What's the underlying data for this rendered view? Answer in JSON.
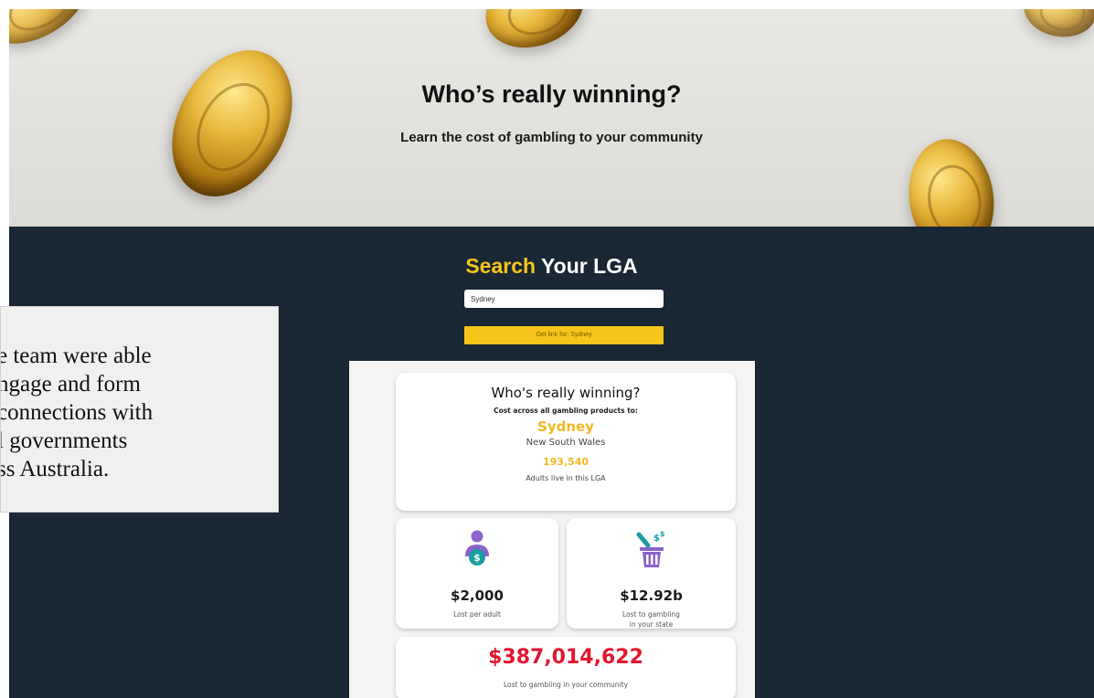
{
  "hero": {
    "title": "Who’s really winning?",
    "subtitle": "Learn the cost of gambling to your community"
  },
  "search": {
    "title_highlight": "Search",
    "title_rest": " Your LGA",
    "input_value": "Sydney",
    "button_label": "Get link for: Sydney"
  },
  "result": {
    "title": "Who's really winning?",
    "subtitle": "Cost across all gambling products to:",
    "city": "Sydney",
    "state": "New South Wales",
    "adults_count": "193,540",
    "adults_label": "Adults live in this LGA"
  },
  "stats": {
    "per_adult_value": "$2,000",
    "per_adult_label": "Lost per adult",
    "per_adult_icon": "person-money-icon",
    "state_value": "$12.92b",
    "state_label_line1": "Lost to gambling",
    "state_label_line2": "in your state",
    "state_icon": "money-bin-icon",
    "community_value": "$387,014,622",
    "community_label": "Lost to gambling in your community"
  },
  "callout": {
    "line1": "e team were able",
    "line2": "ngage and form",
    "line3": " connections with",
    "line4": "l governments",
    "line5": "ss Australia."
  },
  "colors": {
    "dark_bg": "#1a2734",
    "accent_yellow": "#f7c51a",
    "accent_red": "#e1172f",
    "icon_purple": "#8a63c9",
    "icon_teal": "#1a9ea0"
  }
}
